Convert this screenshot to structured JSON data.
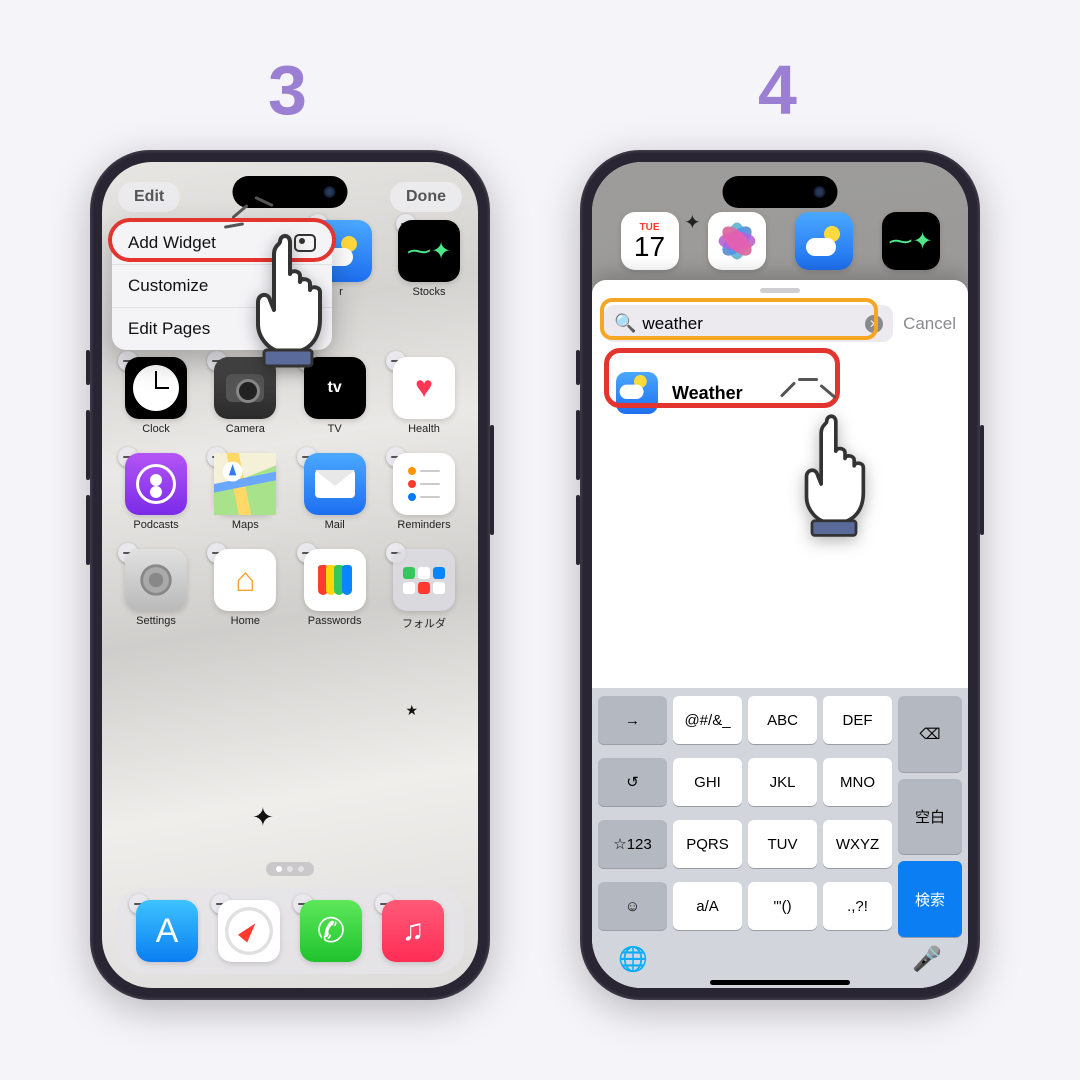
{
  "steps": {
    "s3": "3",
    "s4": "4"
  },
  "screen3": {
    "edit": "Edit",
    "done": "Done",
    "menu": {
      "add_widget": "Add Widget",
      "customize": "Customize",
      "edit_pages": "Edit Pages"
    },
    "partial": {
      "r": "r",
      "stocks": "Stocks"
    },
    "apps": {
      "clock": "Clock",
      "camera": "Camera",
      "tv": "TV",
      "health": "Health",
      "podcasts": "Podcasts",
      "maps": "Maps",
      "mail": "Mail",
      "reminders": "Reminders",
      "settings": "Settings",
      "home": "Home",
      "passwords": "Passwords",
      "folder": "フォルダ"
    },
    "tv_label": "tv"
  },
  "screen4": {
    "calendar": {
      "dow": "TUE",
      "day": "17"
    },
    "search": {
      "query": "weather",
      "cancel": "Cancel"
    },
    "result": {
      "weather": "Weather"
    },
    "keys": {
      "next": "→",
      "k1": "@#/&_",
      "k2": "ABC",
      "k3": "DEF",
      "del": "⌫",
      "undo": "↺",
      "k4": "GHI",
      "k5": "JKL",
      "k6": "MNO",
      "space": "空白",
      "mode": "☆123",
      "k7": "PQRS",
      "k8": "TUV",
      "k9": "WXYZ",
      "search": "検索",
      "emoji": "☺",
      "k10": "a/A",
      "k11": "'\"()",
      "k12": ".,?!",
      "globe": "🌐",
      "mic": "🎤"
    }
  }
}
